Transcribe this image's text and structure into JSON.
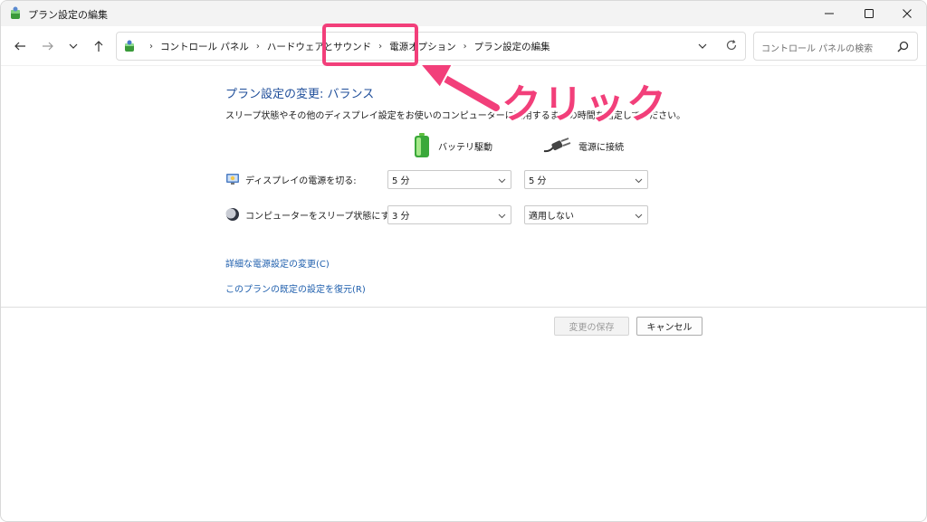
{
  "window": {
    "title": "プラン設定の編集",
    "controls": {
      "minimize_icon": "minimize-icon",
      "maximize_icon": "maximize-icon",
      "close_icon": "close-icon"
    }
  },
  "nav": {
    "icons": [
      "back-arrow-icon",
      "forward-arrow-icon",
      "chevron-down-icon",
      "up-arrow-icon"
    ]
  },
  "breadcrumb": {
    "items": [
      "コントロール パネル",
      "ハードウェアとサウンド",
      "電源オプション",
      "プラン設定の編集"
    ],
    "separator": "›"
  },
  "search": {
    "placeholder": "コントロール パネルの検索"
  },
  "main": {
    "title": "プラン設定の変更: バランス",
    "description": "スリープ状態やその他のディスプレイ設定をお使いのコンピューターに適用するまでの時間を指定してください。",
    "columns": {
      "battery": "バッテリ駆動",
      "plugged": "電源に接続"
    },
    "rows": {
      "display": {
        "label": "ディスプレイの電源を切る:",
        "battery": "5 分",
        "plugged": "5 分"
      },
      "sleep": {
        "label": "コンピューターをスリープ状態にする:",
        "battery": "3 分",
        "plugged": "適用しない"
      }
    },
    "links": {
      "advanced": "詳細な電源設定の変更(C)",
      "restore": "このプランの既定の設定を復元(R)"
    },
    "buttons": {
      "save": "変更の保存",
      "cancel": "キャンセル"
    }
  },
  "annotation": {
    "text": "クリック",
    "color": "#f23f7a"
  }
}
